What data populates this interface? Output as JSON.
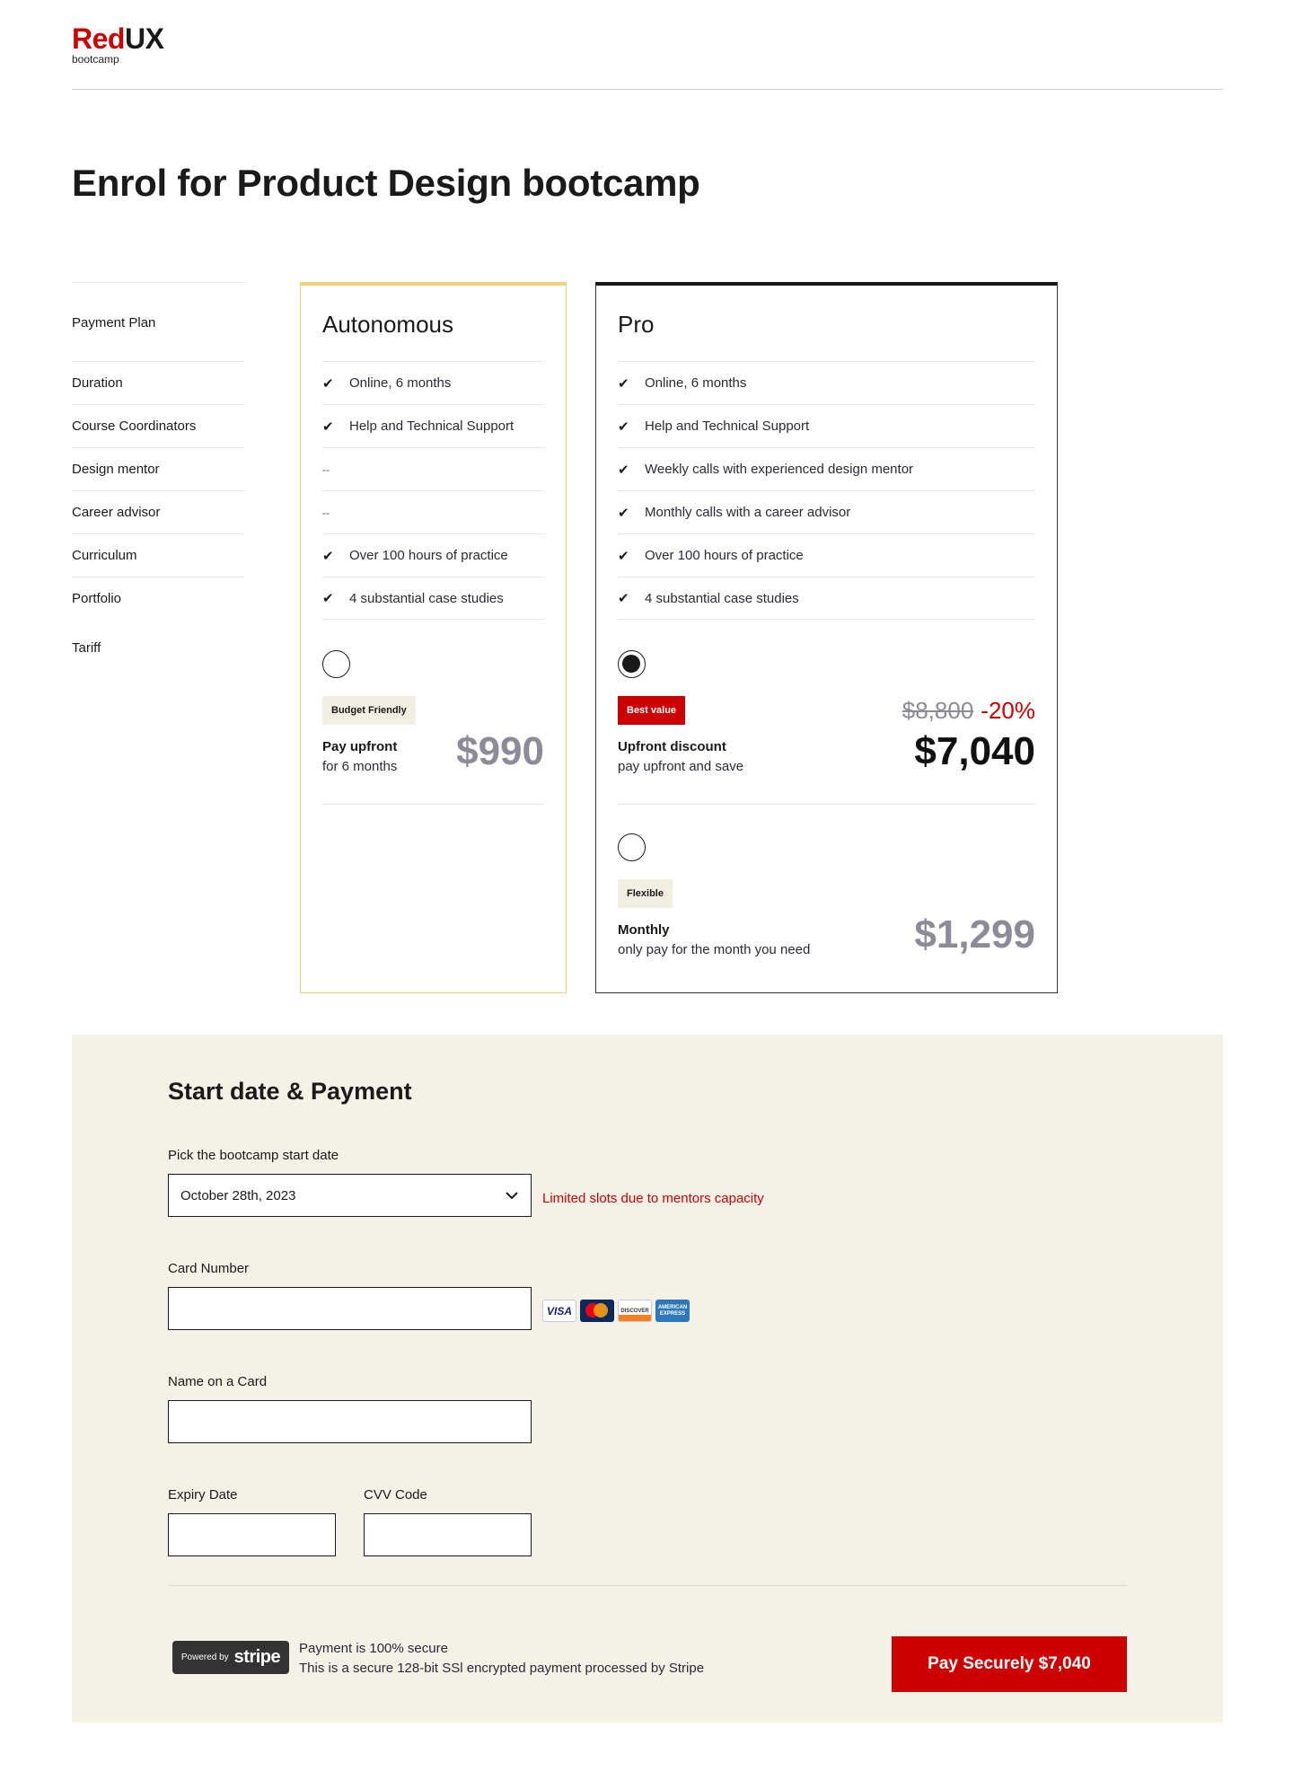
{
  "logo": {
    "brand_red": "Red",
    "brand_dark": "UX",
    "sub": "bootcamp"
  },
  "page_title": "Enrol for Product Design bootcamp",
  "labels": [
    "Payment Plan",
    "Duration",
    "Course Coordinators",
    "Design mentor",
    "Career advisor",
    "Curriculum",
    "Portfolio",
    "Tariff"
  ],
  "plans": {
    "autonomous": {
      "title": "Autonomous",
      "features": [
        {
          "text": "Online, 6 months",
          "included": true
        },
        {
          "text": "Help and Technical Support",
          "included": true
        },
        {
          "text": "--",
          "included": false
        },
        {
          "text": "--",
          "included": false
        },
        {
          "text": "Over 100 hours of practice",
          "included": true
        },
        {
          "text": "4 substantial case studies",
          "included": true
        }
      ],
      "option": {
        "badge": "Budget Friendly",
        "name": "Pay upfront",
        "desc": "for 6 months",
        "price": "$990",
        "selected": false
      }
    },
    "pro": {
      "title": "Pro",
      "features": [
        {
          "text": "Online, 6 months",
          "included": true
        },
        {
          "text": "Help and Technical Support",
          "included": true
        },
        {
          "text": "Weekly calls with experienced design mentor",
          "included": true
        },
        {
          "text": "Monthly calls with a career advisor",
          "included": true
        },
        {
          "text": "Over 100 hours of practice",
          "included": true
        },
        {
          "text": "4 substantial case studies",
          "included": true
        }
      ],
      "option_upfront": {
        "badge": "Best value",
        "old_price": "$8,800",
        "discount": "-20%",
        "name": "Upfront discount",
        "desc": "pay upfront and save",
        "price": "$7,040",
        "selected": true
      },
      "option_monthly": {
        "badge": "Flexible",
        "name": "Monthly",
        "desc": "only pay for the month you need",
        "price": "$1,299",
        "selected": false
      }
    }
  },
  "payment": {
    "title": "Start date & Payment",
    "start_label": "Pick the bootcamp start date",
    "start_value": "October 28th, 2023",
    "capacity_note": "Limited slots due to mentors capacity",
    "card_label": "Card Number",
    "card_brands": [
      "VISA",
      "MasterCard",
      "DISCOVER",
      "AMERICAN EXPRESS"
    ],
    "name_label": "Name on a Card",
    "expiry_label": "Expiry Date",
    "cvv_label": "CVV Code",
    "stripe_powered": "Powered by",
    "stripe_name": "stripe",
    "secure_line1": "Payment is 100% secure",
    "secure_line2": "This is a secure 128-bit SSl encrypted payment processed by Stripe",
    "pay_button": "Pay Securely $7,040"
  },
  "colors": {
    "accent_red": "#cc0000",
    "autonomous_border": "#f3cf7a",
    "panel_bg": "#f4f1e6",
    "price_grey": "#8c8c99"
  }
}
